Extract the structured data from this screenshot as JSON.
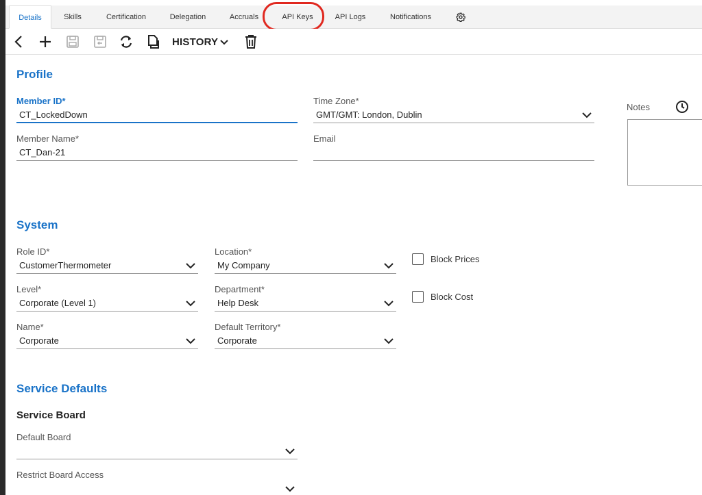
{
  "tabs": [
    {
      "label": "Details",
      "active": true
    },
    {
      "label": "Skills"
    },
    {
      "label": "Certification"
    },
    {
      "label": "Delegation"
    },
    {
      "label": "Accruals"
    },
    {
      "label": "API Keys",
      "highlighted": true
    },
    {
      "label": "API Logs"
    },
    {
      "label": "Notifications"
    },
    {
      "icon": "gear-icon"
    }
  ],
  "toolbar": {
    "icons": [
      "back-icon",
      "add-icon",
      "save-icon",
      "save-and-close-icon",
      "refresh-icon",
      "copy-icon",
      "delete-icon"
    ],
    "history_label": "HISTORY"
  },
  "profile": {
    "title": "Profile",
    "member_id": {
      "label": "Member ID*",
      "value": "CT_LockedDown"
    },
    "time_zone": {
      "label": "Time Zone*",
      "value": "GMT/GMT: London, Dublin"
    },
    "member_name": {
      "label": "Member Name*",
      "value": "CT_Dan-21"
    },
    "email": {
      "label": "Email",
      "value": ""
    },
    "notes": {
      "label": "Notes",
      "value": ""
    }
  },
  "system": {
    "title": "System",
    "role_id": {
      "label": "Role ID*",
      "value": "CustomerThermometer"
    },
    "location": {
      "label": "Location*",
      "value": "My Company"
    },
    "level": {
      "label": "Level*",
      "value": "Corporate (Level 1)"
    },
    "department": {
      "label": "Department*",
      "value": "Help Desk"
    },
    "name": {
      "label": "Name*",
      "value": "Corporate"
    },
    "default_territory": {
      "label": "Default Territory*",
      "value": "Corporate"
    },
    "block_prices": {
      "label": "Block Prices",
      "checked": false
    },
    "block_cost": {
      "label": "Block Cost",
      "checked": false
    }
  },
  "service_defaults": {
    "title": "Service Defaults",
    "service_board_title": "Service Board",
    "default_board": {
      "label": "Default Board",
      "value": ""
    },
    "restrict_board_access": {
      "label": "Restrict Board Access",
      "value": ""
    }
  },
  "colors": {
    "accent": "#1a73c8",
    "highlight_ring": "#e0281f"
  }
}
